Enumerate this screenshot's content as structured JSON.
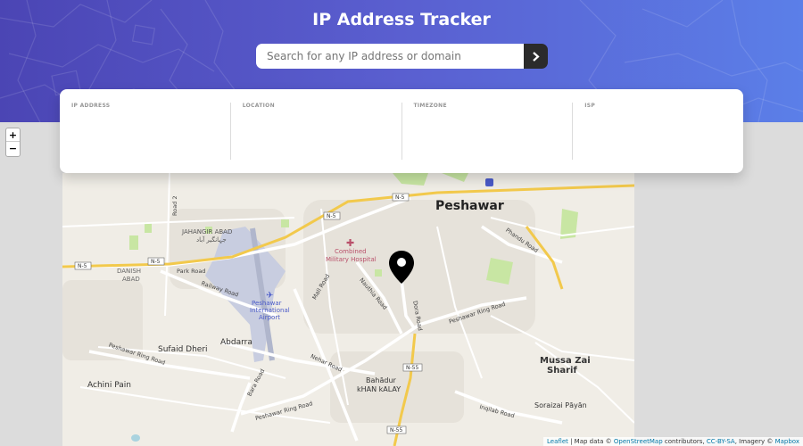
{
  "header": {
    "title": "IP Address Tracker",
    "search_placeholder": "Search for any IP address or domain",
    "search_button_icon": "chevron-right-icon"
  },
  "info": {
    "ip_label": "IP ADDRESS",
    "ip_value": "",
    "location_label": "LOCATION",
    "location_value": "",
    "timezone_label": "TIMEZONE",
    "timezone_value": "",
    "isp_label": "ISP",
    "isp_value": ""
  },
  "map": {
    "zoom_in": "+",
    "zoom_out": "−",
    "places": {
      "peshawar": "Peshawar",
      "jahangir_abad": "JAHANGIR ABAD",
      "jahangir_abad_urdu": "جہانگیر آباد",
      "danish_abad_1": "DANISH",
      "danish_abad_2": "ABAD",
      "cmh_1": "Combined",
      "cmh_2": "Military Hospital",
      "airport_1": "Peshawar",
      "airport_2": "International",
      "airport_3": "Airport",
      "abdarra": "Abdarra",
      "sufaid_dheri": "Sufaid Dheri",
      "achini_pain": "Achini Pain",
      "mussa_zai_1": "Mussa Zai",
      "mussa_zai_2": "Sharif",
      "soraizai": "Soraizai Pāyān",
      "bahadur_1": "Bahādur",
      "bahadur_2": "kHAN kALAY"
    },
    "roads": {
      "road2": "Road 2",
      "park_road": "Park Road",
      "railway_road": "Railway Road",
      "mall_road": "Mall Road",
      "nauthia_road": "Nauthia Road",
      "dora_road": "Dora Road",
      "ring_road_1": "Peshawar Ring Road",
      "ring_road_2": "Peshawar Ring Road",
      "ring_road_3": "Peshawar Ring Road",
      "nehar_road": "Nehar Road",
      "bara_road": "Bara Road",
      "inqilab_road": "Inqilab Road",
      "phandu_road": "Phandu Road"
    },
    "shields": {
      "n5_a": "N-5",
      "n5_b": "N-5",
      "n5_c": "N-5",
      "n5_d": "N-5",
      "n55_a": "N-55",
      "n55_b": "N-55"
    },
    "colors": {
      "background": "#f0ede6",
      "water": "#aad3df",
      "park": "#c8e6a3",
      "motorway": "#f2c94c",
      "airport": "#c8cde0",
      "marker": "#000000"
    },
    "attribution": {
      "leaflet": "Leaflet",
      "sep1": " | Map data © ",
      "osm": "OpenStreetMap",
      "sep2": " contributors, ",
      "ccbysa": "CC-BY-SA",
      "sep3": ", Imagery © ",
      "mapbox": "Mapbox"
    }
  }
}
